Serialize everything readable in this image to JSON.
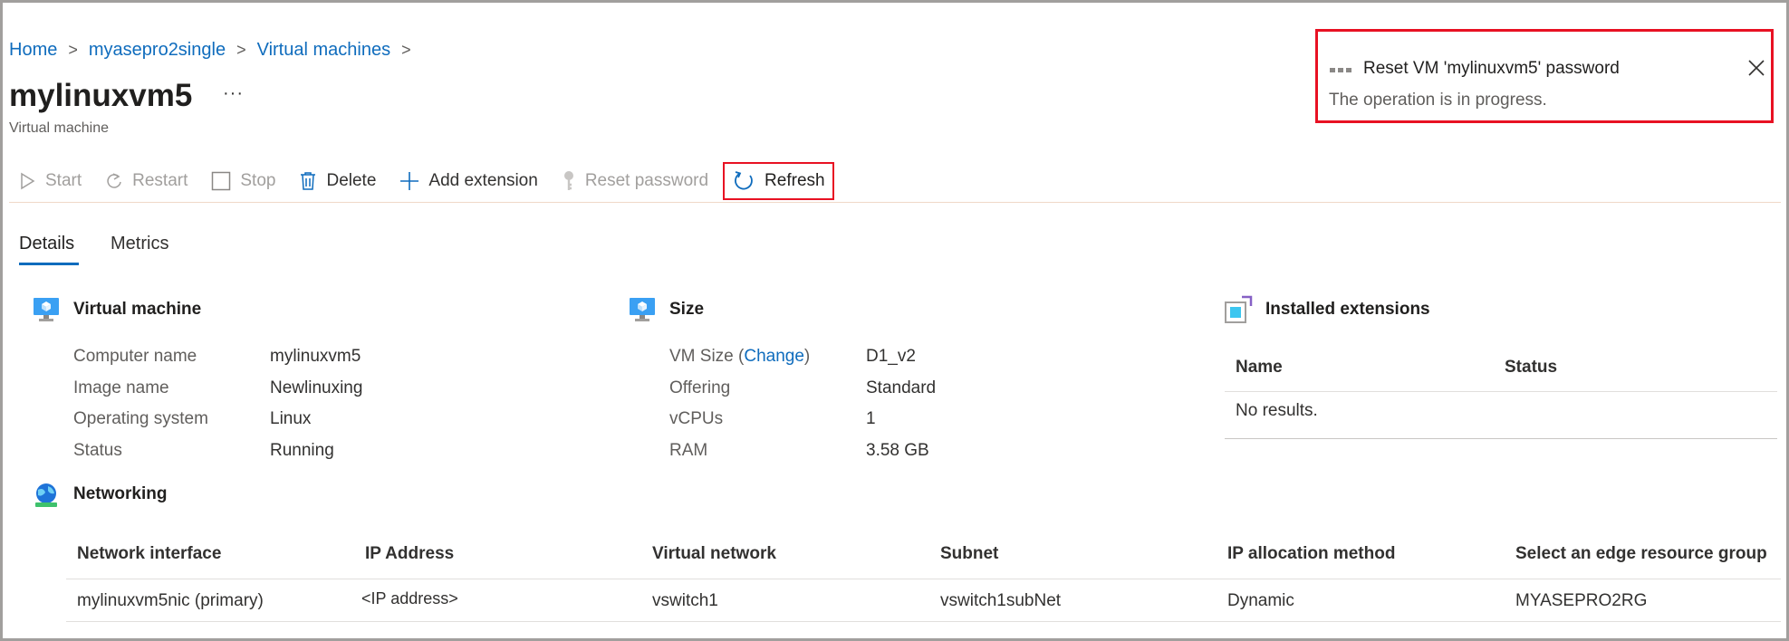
{
  "breadcrumb": {
    "items": [
      "Home",
      "myasepro2single",
      "Virtual machines"
    ],
    "separator": ">"
  },
  "page": {
    "title": "mylinuxvm5",
    "more": "···",
    "subtitle": "Virtual machine"
  },
  "toolbar": {
    "start": "Start",
    "restart": "Restart",
    "stop": "Stop",
    "delete": "Delete",
    "add_extension": "Add extension",
    "reset_password": "Reset password",
    "refresh": "Refresh"
  },
  "tabs": [
    "Details",
    "Metrics"
  ],
  "vm_section": {
    "title": "Virtual machine",
    "rows": [
      {
        "key": "Computer name",
        "value": "mylinuxvm5"
      },
      {
        "key": "Image name",
        "value": "Newlinuxing"
      },
      {
        "key": "Operating system",
        "value": "Linux"
      },
      {
        "key": "Status",
        "value": "Running"
      }
    ]
  },
  "size_section": {
    "title": "Size",
    "vm_size_key_prefix": "VM Size (",
    "vm_size_link": "Change",
    "vm_size_key_suffix": ")",
    "vm_size_value": "D1_v2",
    "rows": [
      {
        "key": "Offering",
        "value": "Standard"
      },
      {
        "key": "vCPUs",
        "value": "1"
      },
      {
        "key": "RAM",
        "value": "3.58 GB"
      }
    ]
  },
  "extensions_section": {
    "title": "Installed extensions",
    "columns": [
      "Name",
      "Status"
    ],
    "empty": "No results."
  },
  "networking": {
    "title": "Networking",
    "columns": [
      "Network interface",
      "IP Address",
      "Virtual network",
      "Subnet",
      "IP allocation method",
      "Select an edge resource group"
    ],
    "rows": [
      [
        "mylinuxvm5nic (primary)",
        "<IP address>",
        "vswitch1",
        "vswitch1subNet",
        "Dynamic",
        "MYASEPRO2RG"
      ]
    ]
  },
  "notification": {
    "title": "Reset VM 'mylinuxvm5' password",
    "message": "The operation is in progress."
  },
  "colors": {
    "accent": "#0f6cbd",
    "highlight": "#e81123"
  }
}
